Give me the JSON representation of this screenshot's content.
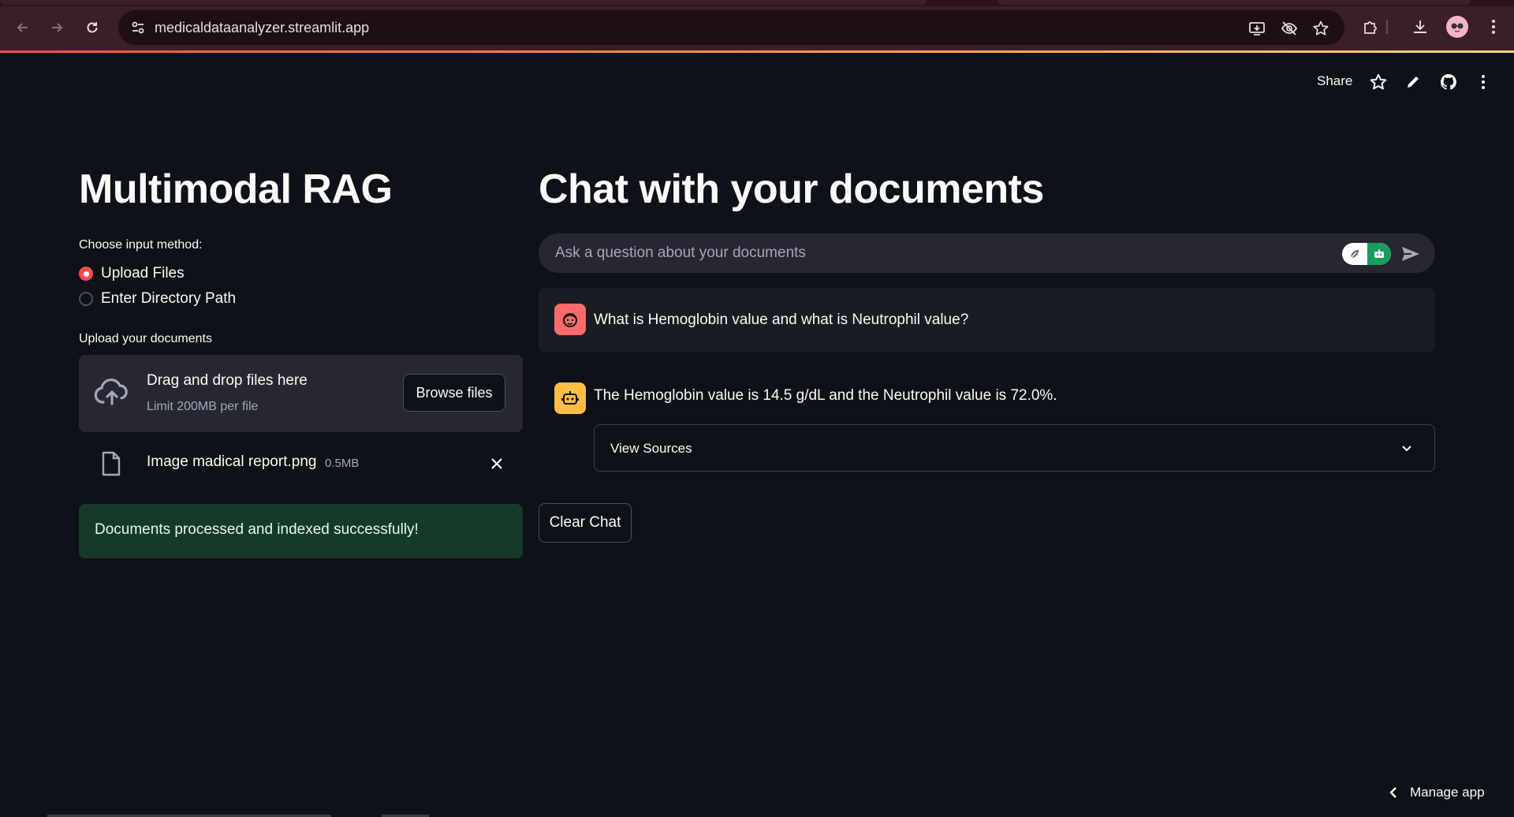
{
  "browser": {
    "url": "medicaldataanalyzer.streamlit.app"
  },
  "header": {
    "share_label": "Share"
  },
  "sidebar_panel": {
    "title": "Multimodal RAG",
    "input_method_label": "Choose input method:",
    "radio_options": [
      {
        "label": "Upload Files",
        "selected": true
      },
      {
        "label": "Enter Directory Path",
        "selected": false
      }
    ],
    "upload_label": "Upload your documents",
    "dropzone_title": "Drag and drop files here",
    "dropzone_limit": "Limit 200MB per file",
    "browse_label": "Browse files",
    "uploaded_file": {
      "name": "Image madical report.png",
      "size": "0.5MB"
    },
    "success_message": "Documents processed and indexed successfully!"
  },
  "chat": {
    "title": "Chat with your documents",
    "input_placeholder": "Ask a question about your documents",
    "messages": [
      {
        "role": "user",
        "text": "What is Hemoglobin value and what is Neutrophil value?"
      },
      {
        "role": "assistant",
        "text": "The Hemoglobin value is 14.5 g/dL and the Neutrophil value is 72.0%."
      }
    ],
    "view_sources_label": "View Sources",
    "clear_chat_label": "Clear Chat"
  },
  "footer": {
    "manage_app_label": "Manage app"
  },
  "colors": {
    "background": "#0e1117",
    "accent": "#ff4b4b",
    "user_avatar": "#ff6b6b",
    "assistant_avatar": "#ffbd45",
    "success_bg": "#173928"
  }
}
